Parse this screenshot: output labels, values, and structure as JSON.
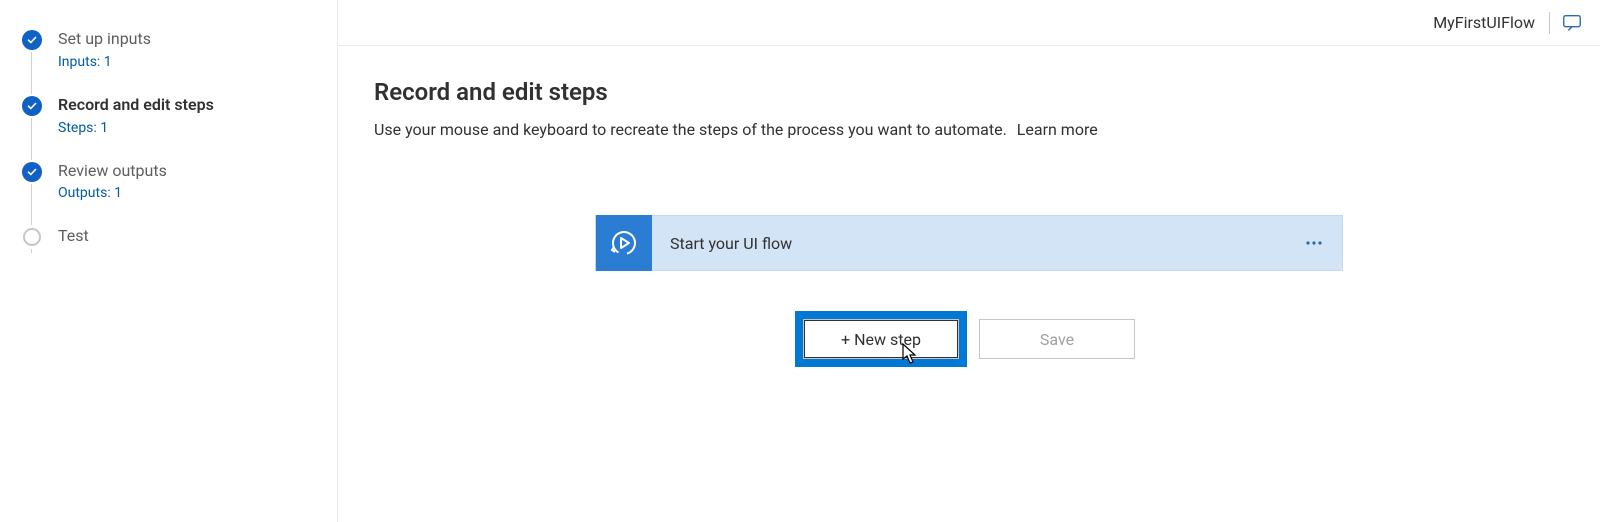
{
  "header": {
    "flow_name": "MyFirstUIFlow"
  },
  "sidebar": {
    "items": [
      {
        "label": "Set up inputs",
        "sub": "Inputs: 1",
        "done": true,
        "active": false
      },
      {
        "label": "Record and edit steps",
        "sub": "Steps: 1",
        "done": true,
        "active": true
      },
      {
        "label": "Review outputs",
        "sub": "Outputs: 1",
        "done": true,
        "active": false
      },
      {
        "label": "Test",
        "sub": "",
        "done": false,
        "active": false
      }
    ]
  },
  "page": {
    "title": "Record and edit steps",
    "description": "Use your mouse and keyboard to recreate the steps of the process you want to automate.",
    "learn_more": "Learn more"
  },
  "flow_card": {
    "title": "Start your UI flow"
  },
  "buttons": {
    "new_step": "+ New step",
    "save": "Save"
  }
}
